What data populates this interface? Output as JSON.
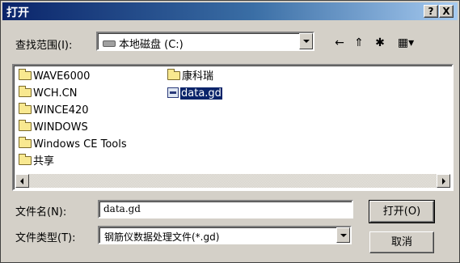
{
  "window": {
    "title": "打开",
    "help_label": "?",
    "close_label": "X"
  },
  "lookin": {
    "label": "查找范围(I):",
    "value": "本地磁盘 (C:)"
  },
  "toolbar": {
    "back_icon": "←",
    "up_icon": "⇑",
    "newfolder_icon": "✱",
    "view_icon": "▦▾"
  },
  "files": [
    {
      "name": "WAVE6000",
      "type": "folder"
    },
    {
      "name": "WCH.CN",
      "type": "folder"
    },
    {
      "name": "WINCE420",
      "type": "folder"
    },
    {
      "name": "WINDOWS",
      "type": "folder"
    },
    {
      "name": "Windows CE Tools",
      "type": "folder"
    },
    {
      "name": "共享",
      "type": "folder"
    },
    {
      "name": "康科瑞",
      "type": "folder"
    },
    {
      "name": "data.gd",
      "type": "file",
      "selected": true
    }
  ],
  "filename": {
    "label": "文件名(N):",
    "value": "data.gd"
  },
  "filetype": {
    "label": "文件类型(T):",
    "value": "钢筋仪数据处理文件(*.gd)"
  },
  "buttons": {
    "open": "打开(O)",
    "cancel": "取消"
  },
  "colors": {
    "titlebar_start": "#0a246a",
    "titlebar_end": "#a6caf0",
    "dialog_bg": "#d4d0c8",
    "selection": "#0a246a"
  }
}
